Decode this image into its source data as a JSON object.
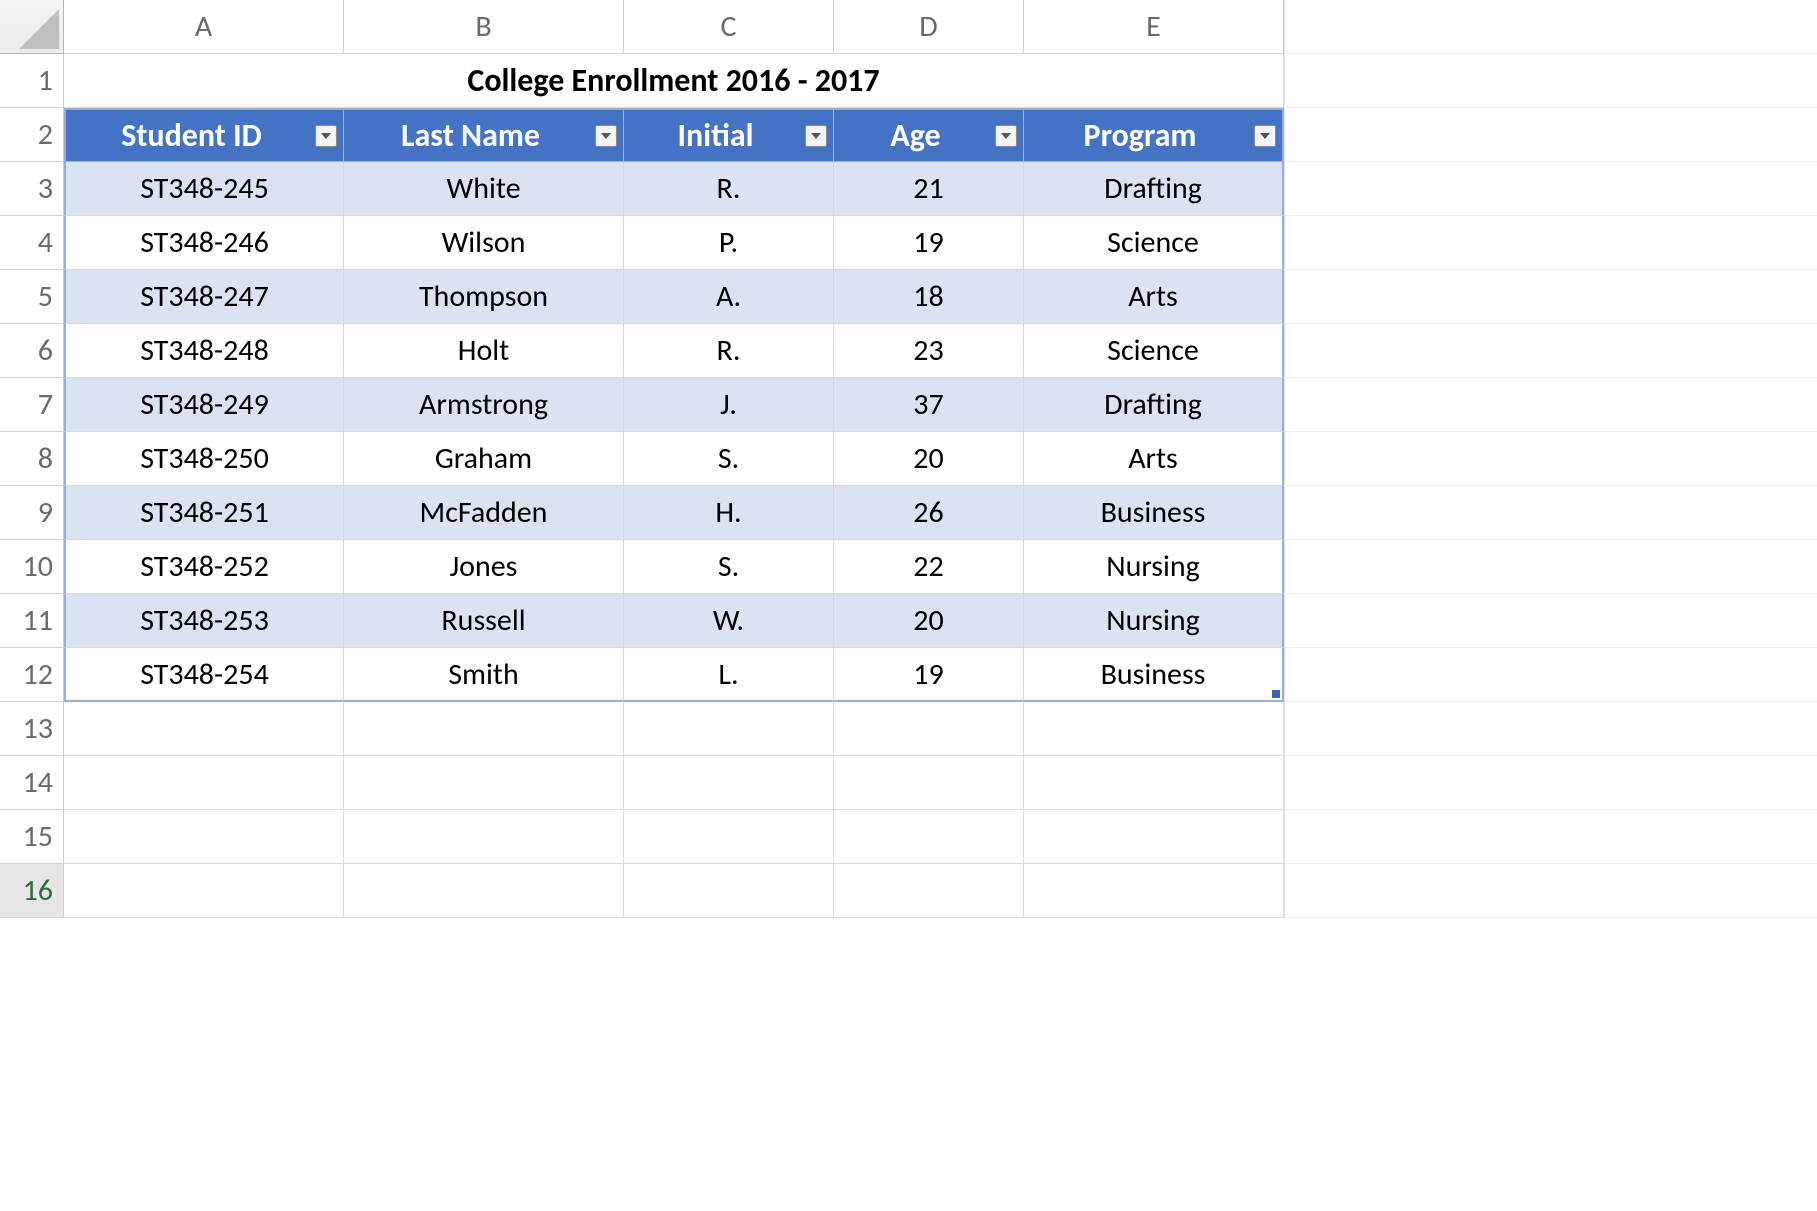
{
  "columns": [
    "A",
    "B",
    "C",
    "D",
    "E"
  ],
  "row_numbers": [
    "1",
    "2",
    "3",
    "4",
    "5",
    "6",
    "7",
    "8",
    "9",
    "10",
    "11",
    "12",
    "13",
    "14",
    "15",
    "16"
  ],
  "active_row_index": 15,
  "title": "College Enrollment 2016 - 2017",
  "table": {
    "headers": [
      "Student ID",
      "Last Name",
      "Initial",
      "Age",
      "Program"
    ],
    "rows": [
      {
        "id": "ST348-245",
        "last": "White",
        "initial": "R.",
        "age": "21",
        "program": "Drafting"
      },
      {
        "id": "ST348-246",
        "last": "Wilson",
        "initial": "P.",
        "age": "19",
        "program": "Science"
      },
      {
        "id": "ST348-247",
        "last": "Thompson",
        "initial": "A.",
        "age": "18",
        "program": "Arts"
      },
      {
        "id": "ST348-248",
        "last": "Holt",
        "initial": "R.",
        "age": "23",
        "program": "Science"
      },
      {
        "id": "ST348-249",
        "last": "Armstrong",
        "initial": "J.",
        "age": "37",
        "program": "Drafting"
      },
      {
        "id": "ST348-250",
        "last": "Graham",
        "initial": "S.",
        "age": "20",
        "program": "Arts"
      },
      {
        "id": "ST348-251",
        "last": "McFadden",
        "initial": "H.",
        "age": "26",
        "program": "Business"
      },
      {
        "id": "ST348-252",
        "last": "Jones",
        "initial": "S.",
        "age": "22",
        "program": "Nursing"
      },
      {
        "id": "ST348-253",
        "last": "Russell",
        "initial": "W.",
        "age": "20",
        "program": "Nursing"
      },
      {
        "id": "ST348-254",
        "last": "Smith",
        "initial": "L.",
        "age": "19",
        "program": "Business"
      }
    ]
  }
}
